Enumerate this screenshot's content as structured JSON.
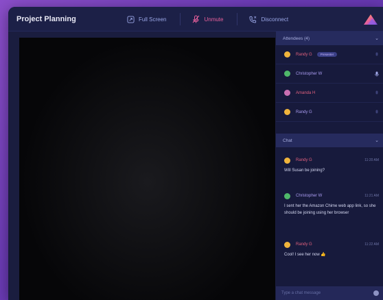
{
  "app": {
    "title": "Project Planning"
  },
  "toolbar": {
    "fullscreen_label": "Full Screen",
    "unmute_label": "Unmute",
    "disconnect_label": "Disconnect"
  },
  "attendees": {
    "header": "Attendees (4)",
    "items": [
      {
        "name": "Randy G",
        "badge": "Presenter",
        "color": "#e0607e",
        "avatar": "#f0b43c",
        "mic": "muted"
      },
      {
        "name": "Christopher W",
        "color": "#a99bf0",
        "avatar": "#4fb86a",
        "mic": "active"
      },
      {
        "name": "Amanda H",
        "color": "#e0607e",
        "avatar": "#c96fb2",
        "mic": "muted"
      },
      {
        "name": "Randy G",
        "color": "#a99bf0",
        "avatar": "#f0b43c",
        "mic": "muted"
      }
    ]
  },
  "chat": {
    "header": "Chat",
    "messages": [
      {
        "sender": "Randy G",
        "time": "11:20 AM",
        "text": "Will Susan be joining?",
        "color": "#e0607e",
        "avatar": "#f0b43c"
      },
      {
        "sender": "Christopher W",
        "time": "11:21 AM",
        "text": "I sent her the Amazon Chime web app link, so she should be joining using her browser",
        "color": "#a99bf0",
        "avatar": "#4fb86a"
      },
      {
        "sender": "Randy G",
        "time": "11:22 AM",
        "text": "Cool! I see her now 👍",
        "color": "#e0607e",
        "avatar": "#f0b43c"
      }
    ],
    "input_placeholder": "Type a chat message"
  },
  "colors": {
    "accent_pink": "#e8609c",
    "accent_blue": "#9aa6e6",
    "panel": "#171a3c"
  }
}
